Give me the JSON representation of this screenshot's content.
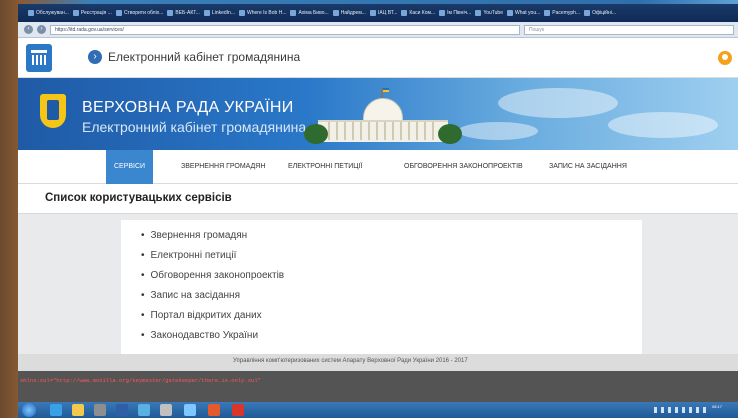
{
  "browser": {
    "bookmarks": [
      "Обслужуван...",
      "Реєстрація ...",
      "Створити обліх...",
      "ВЕБ-АКТ...",
      "LinkedIn...",
      "Where Is Bob H...",
      "Ахіма Биво...",
      "Найдрем...",
      "ІАЦ ВТ...",
      "Каси Ком...",
      "Ім Північ...",
      "YouTube",
      "What you...",
      "Pacemyph...",
      "Офіційні..."
    ],
    "url": "https://itd.rada.gov.ua/services/",
    "search_placeholder": "Пошук"
  },
  "header": {
    "title": "Електронний кабінет громадянина"
  },
  "banner": {
    "line1": "ВЕРХОВНА РАДА УКРАЇНИ",
    "line2": "Електронний кабінет громадянина"
  },
  "nav": {
    "items": [
      {
        "label": "СЕРВІСИ",
        "active": true
      },
      {
        "label": "ЗВЕРНЕННЯ ГРОМАДЯН",
        "active": false
      },
      {
        "label": "ЕЛЕКТРОННІ ПЕТИЦІЇ",
        "active": false
      },
      {
        "label": "ОБГОВОРЕННЯ ЗАКОНОПРОЕКТІВ",
        "active": false
      },
      {
        "label": "ЗАПИС НА ЗАСІДАННЯ",
        "active": false
      }
    ]
  },
  "main": {
    "heading": "Список користувацьких сервісів",
    "services": [
      "Звернення громадян",
      "Електронні петиції",
      "Обговорення законопроектів",
      "Запис на засідання",
      "Портал відкритих даних",
      "Законодавство України"
    ]
  },
  "footer": {
    "text": "Управління комп'ютеризованих систем Апарату Верховної Ради України 2016 - 2017"
  },
  "status": {
    "text": "xmlns:xul=\"http://www.mozilla.org/keymaster/gatekeeper/there.is.only.xul\""
  },
  "taskbar": {
    "clock": "08:17"
  },
  "colors": {
    "nav_active": "#3a86cf",
    "banner_blue": "#1f5aa6",
    "status_bg": "#545454",
    "status_text": "#ff5555"
  }
}
